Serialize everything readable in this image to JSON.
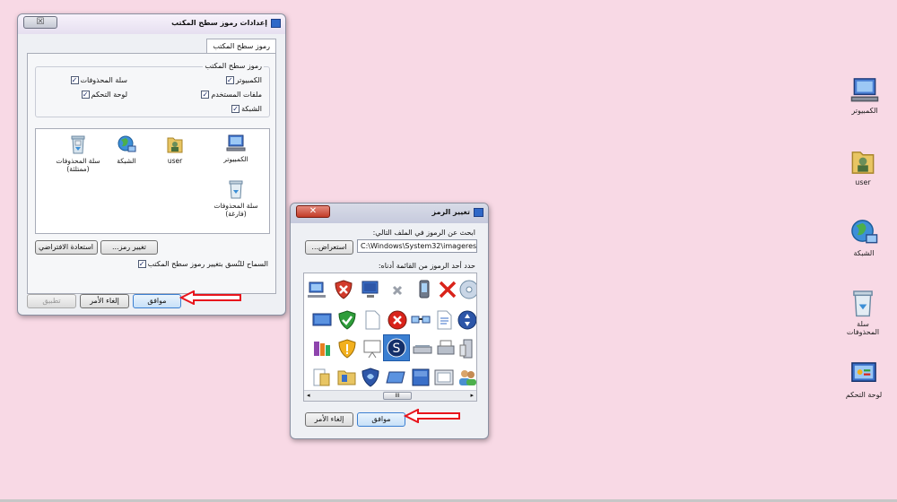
{
  "settings_dialog": {
    "title": "إعدادات رموز سطح المكتب",
    "close_glyph": "☒",
    "tab_label": "رموز سطح المكتب",
    "group_label": "رموز سطح المكتب",
    "checkboxes": [
      {
        "label": "الكمبيوتر",
        "checked": true
      },
      {
        "label": "سلة المحذوفات",
        "checked": true
      },
      {
        "label": "ملفات المستخدم",
        "checked": true
      },
      {
        "label": "لوحة التحكم",
        "checked": true
      },
      {
        "label": "الشبكة",
        "checked": true
      }
    ],
    "icons": [
      {
        "label": "الكمبيوتر",
        "icon": "computer-icon"
      },
      {
        "label": "user",
        "icon": "user-folder-icon"
      },
      {
        "label": "الشبكة",
        "icon": "network-icon"
      },
      {
        "label": "سلة المحذوفات (ممتلئة)",
        "icon": "recycle-bin-full-icon"
      },
      {
        "label": "سلة المحذوفات (فارغة)",
        "icon": "recycle-bin-empty-icon"
      }
    ],
    "change_icon_btn": "تغيير رمز...",
    "restore_default_btn": "استعادة الافتراضي",
    "allow_themes_label": "السماح للنُسق بتغيير رموز سطح المكتب",
    "allow_themes_checked": true,
    "ok_btn": "موافق",
    "cancel_btn": "إلغاء الأمر",
    "apply_btn": "تطبيق"
  },
  "change_icon_dialog": {
    "title": "تغيير الرمز",
    "close_glyph": "✕",
    "search_label": "ابحث عن الرموز في الملف التالي:",
    "file_path": "C:\\Windows\\System32\\imageres.dll",
    "browse_btn": "استعراض...",
    "select_label": "حدد أحد الرموز من القائمة أدناه:",
    "scroll_label": "III",
    "ok_btn": "موافق",
    "cancel_btn": "إلغاء الأمر"
  },
  "desktop": {
    "icons": [
      {
        "label": "الكمبيوتر",
        "icon": "computer-icon"
      },
      {
        "label": "user",
        "icon": "user-folder-icon"
      },
      {
        "label": "الشبكة",
        "icon": "network-icon"
      },
      {
        "label": "سلة المحذوفات",
        "icon": "recycle-bin-icon"
      },
      {
        "label": "لوحة التحكم",
        "icon": "control-panel-icon"
      }
    ]
  },
  "colors": {
    "desktop_bg": "#f8d9e5",
    "arrow": "#e8141c",
    "selection": "#3b7fd1"
  }
}
